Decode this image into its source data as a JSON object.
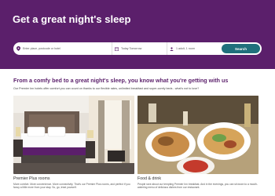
{
  "hero": {
    "title": "Get a great night's sleep",
    "background": "#5b1f6b"
  },
  "search": {
    "location_placeholder": "Enter place, postcode or hotel",
    "dates_label": "Today   Tomorrow",
    "rooms_label": "1 adult, 1 room",
    "button_label": "Search",
    "button_color": "#20707c"
  },
  "content": {
    "headline": "From a comfy bed to a great night's sleep, you know what you're getting with us",
    "intro": "Our Premier Inn hotels offer comfort you can count on thanks to our flexible rates, unlimited breakfast and super-comfy beds - what's not to love?"
  },
  "cards": [
    {
      "title": "Premier Plus rooms",
      "desc": "More comfort. More convenience. More connectivity. That's our Premier Plus rooms, and perfect if you fancy a little more from your stay. So, go, treat yourself."
    },
    {
      "title": "Food & drink",
      "desc": "People rave about our tempting Premier Inn breakfast. And in the evenings, you can sit down to a mouth-watering menu of delicious dishes from our restaurant."
    }
  ]
}
